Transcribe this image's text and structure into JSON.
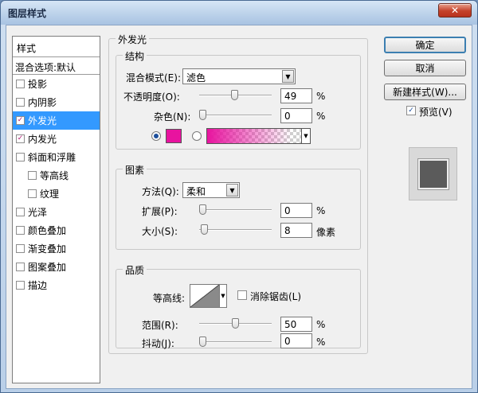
{
  "window": {
    "title": "图层样式",
    "close_glyph": "✕"
  },
  "styles_panel": {
    "header": "样式",
    "blend_options": "混合选项:默认",
    "items": [
      {
        "label": "投影",
        "checked": false,
        "active": false,
        "sub": false
      },
      {
        "label": "内阴影",
        "checked": false,
        "active": false,
        "sub": false
      },
      {
        "label": "外发光",
        "checked": true,
        "active": true,
        "sub": false
      },
      {
        "label": "内发光",
        "checked": true,
        "active": false,
        "sub": false
      },
      {
        "label": "斜面和浮雕",
        "checked": false,
        "active": false,
        "sub": false
      },
      {
        "label": "等高线",
        "checked": false,
        "active": false,
        "sub": true
      },
      {
        "label": "纹理",
        "checked": false,
        "active": false,
        "sub": true
      },
      {
        "label": "光泽",
        "checked": false,
        "active": false,
        "sub": false
      },
      {
        "label": "颜色叠加",
        "checked": false,
        "active": false,
        "sub": false
      },
      {
        "label": "渐变叠加",
        "checked": false,
        "active": false,
        "sub": false
      },
      {
        "label": "图案叠加",
        "checked": false,
        "active": false,
        "sub": false
      },
      {
        "label": "描边",
        "checked": false,
        "active": false,
        "sub": false
      }
    ]
  },
  "outer_glow": {
    "title": "外发光",
    "structure": {
      "title": "结构",
      "blend_mode_label": "混合模式(E):",
      "blend_mode_value": "滤色",
      "opacity_label": "不透明度(O):",
      "opacity_value": "49",
      "opacity_unit": "%",
      "opacity_level": 0.49,
      "noise_label": "杂色(N):",
      "noise_value": "0",
      "noise_unit": "%",
      "noise_level": 0,
      "color": "#e8139f"
    },
    "elements": {
      "title": "图素",
      "technique_label": "方法(Q):",
      "technique_value": "柔和",
      "spread_label": "扩展(P):",
      "spread_value": "0",
      "spread_unit": "%",
      "spread_level": 0,
      "size_label": "大小(S):",
      "size_value": "8",
      "size_unit": "像素",
      "size_level": 0.03
    },
    "quality": {
      "title": "品质",
      "contour_label": "等高线:",
      "antialias_label": "消除锯齿(L)",
      "range_label": "范围(R):",
      "range_value": "50",
      "range_unit": "%",
      "range_level": 0.5,
      "jitter_label": "抖动(J):",
      "jitter_value": "0",
      "jitter_unit": "%",
      "jitter_level": 0
    }
  },
  "buttons": {
    "ok": "确定",
    "cancel": "取消",
    "new_style": "新建样式(W)...",
    "preview_label": "预览(V)"
  }
}
